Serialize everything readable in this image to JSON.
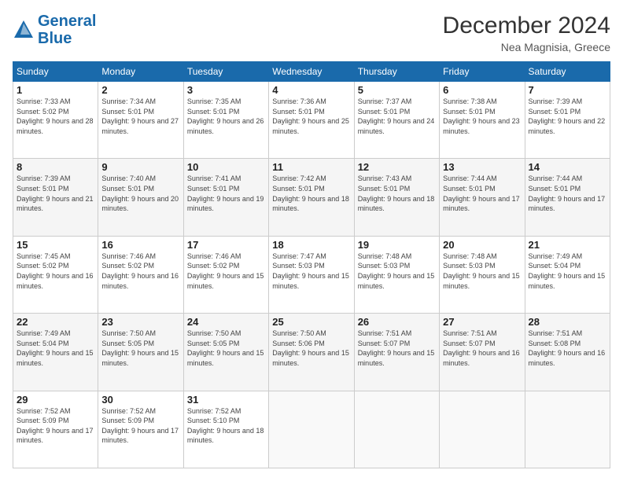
{
  "logo": {
    "line1": "General",
    "line2": "Blue"
  },
  "title": "December 2024",
  "location": "Nea Magnisia, Greece",
  "days_of_week": [
    "Sunday",
    "Monday",
    "Tuesday",
    "Wednesday",
    "Thursday",
    "Friday",
    "Saturday"
  ],
  "weeks": [
    [
      {
        "day": "1",
        "sunrise": "Sunrise: 7:33 AM",
        "sunset": "Sunset: 5:02 PM",
        "daylight": "Daylight: 9 hours and 28 minutes."
      },
      {
        "day": "2",
        "sunrise": "Sunrise: 7:34 AM",
        "sunset": "Sunset: 5:01 PM",
        "daylight": "Daylight: 9 hours and 27 minutes."
      },
      {
        "day": "3",
        "sunrise": "Sunrise: 7:35 AM",
        "sunset": "Sunset: 5:01 PM",
        "daylight": "Daylight: 9 hours and 26 minutes."
      },
      {
        "day": "4",
        "sunrise": "Sunrise: 7:36 AM",
        "sunset": "Sunset: 5:01 PM",
        "daylight": "Daylight: 9 hours and 25 minutes."
      },
      {
        "day": "5",
        "sunrise": "Sunrise: 7:37 AM",
        "sunset": "Sunset: 5:01 PM",
        "daylight": "Daylight: 9 hours and 24 minutes."
      },
      {
        "day": "6",
        "sunrise": "Sunrise: 7:38 AM",
        "sunset": "Sunset: 5:01 PM",
        "daylight": "Daylight: 9 hours and 23 minutes."
      },
      {
        "day": "7",
        "sunrise": "Sunrise: 7:39 AM",
        "sunset": "Sunset: 5:01 PM",
        "daylight": "Daylight: 9 hours and 22 minutes."
      }
    ],
    [
      {
        "day": "8",
        "sunrise": "Sunrise: 7:39 AM",
        "sunset": "Sunset: 5:01 PM",
        "daylight": "Daylight: 9 hours and 21 minutes."
      },
      {
        "day": "9",
        "sunrise": "Sunrise: 7:40 AM",
        "sunset": "Sunset: 5:01 PM",
        "daylight": "Daylight: 9 hours and 20 minutes."
      },
      {
        "day": "10",
        "sunrise": "Sunrise: 7:41 AM",
        "sunset": "Sunset: 5:01 PM",
        "daylight": "Daylight: 9 hours and 19 minutes."
      },
      {
        "day": "11",
        "sunrise": "Sunrise: 7:42 AM",
        "sunset": "Sunset: 5:01 PM",
        "daylight": "Daylight: 9 hours and 18 minutes."
      },
      {
        "day": "12",
        "sunrise": "Sunrise: 7:43 AM",
        "sunset": "Sunset: 5:01 PM",
        "daylight": "Daylight: 9 hours and 18 minutes."
      },
      {
        "day": "13",
        "sunrise": "Sunrise: 7:44 AM",
        "sunset": "Sunset: 5:01 PM",
        "daylight": "Daylight: 9 hours and 17 minutes."
      },
      {
        "day": "14",
        "sunrise": "Sunrise: 7:44 AM",
        "sunset": "Sunset: 5:01 PM",
        "daylight": "Daylight: 9 hours and 17 minutes."
      }
    ],
    [
      {
        "day": "15",
        "sunrise": "Sunrise: 7:45 AM",
        "sunset": "Sunset: 5:02 PM",
        "daylight": "Daylight: 9 hours and 16 minutes."
      },
      {
        "day": "16",
        "sunrise": "Sunrise: 7:46 AM",
        "sunset": "Sunset: 5:02 PM",
        "daylight": "Daylight: 9 hours and 16 minutes."
      },
      {
        "day": "17",
        "sunrise": "Sunrise: 7:46 AM",
        "sunset": "Sunset: 5:02 PM",
        "daylight": "Daylight: 9 hours and 15 minutes."
      },
      {
        "day": "18",
        "sunrise": "Sunrise: 7:47 AM",
        "sunset": "Sunset: 5:03 PM",
        "daylight": "Daylight: 9 hours and 15 minutes."
      },
      {
        "day": "19",
        "sunrise": "Sunrise: 7:48 AM",
        "sunset": "Sunset: 5:03 PM",
        "daylight": "Daylight: 9 hours and 15 minutes."
      },
      {
        "day": "20",
        "sunrise": "Sunrise: 7:48 AM",
        "sunset": "Sunset: 5:03 PM",
        "daylight": "Daylight: 9 hours and 15 minutes."
      },
      {
        "day": "21",
        "sunrise": "Sunrise: 7:49 AM",
        "sunset": "Sunset: 5:04 PM",
        "daylight": "Daylight: 9 hours and 15 minutes."
      }
    ],
    [
      {
        "day": "22",
        "sunrise": "Sunrise: 7:49 AM",
        "sunset": "Sunset: 5:04 PM",
        "daylight": "Daylight: 9 hours and 15 minutes."
      },
      {
        "day": "23",
        "sunrise": "Sunrise: 7:50 AM",
        "sunset": "Sunset: 5:05 PM",
        "daylight": "Daylight: 9 hours and 15 minutes."
      },
      {
        "day": "24",
        "sunrise": "Sunrise: 7:50 AM",
        "sunset": "Sunset: 5:05 PM",
        "daylight": "Daylight: 9 hours and 15 minutes."
      },
      {
        "day": "25",
        "sunrise": "Sunrise: 7:50 AM",
        "sunset": "Sunset: 5:06 PM",
        "daylight": "Daylight: 9 hours and 15 minutes."
      },
      {
        "day": "26",
        "sunrise": "Sunrise: 7:51 AM",
        "sunset": "Sunset: 5:07 PM",
        "daylight": "Daylight: 9 hours and 15 minutes."
      },
      {
        "day": "27",
        "sunrise": "Sunrise: 7:51 AM",
        "sunset": "Sunset: 5:07 PM",
        "daylight": "Daylight: 9 hours and 16 minutes."
      },
      {
        "day": "28",
        "sunrise": "Sunrise: 7:51 AM",
        "sunset": "Sunset: 5:08 PM",
        "daylight": "Daylight: 9 hours and 16 minutes."
      }
    ],
    [
      {
        "day": "29",
        "sunrise": "Sunrise: 7:52 AM",
        "sunset": "Sunset: 5:09 PM",
        "daylight": "Daylight: 9 hours and 17 minutes."
      },
      {
        "day": "30",
        "sunrise": "Sunrise: 7:52 AM",
        "sunset": "Sunset: 5:09 PM",
        "daylight": "Daylight: 9 hours and 17 minutes."
      },
      {
        "day": "31",
        "sunrise": "Sunrise: 7:52 AM",
        "sunset": "Sunset: 5:10 PM",
        "daylight": "Daylight: 9 hours and 18 minutes."
      },
      null,
      null,
      null,
      null
    ]
  ]
}
